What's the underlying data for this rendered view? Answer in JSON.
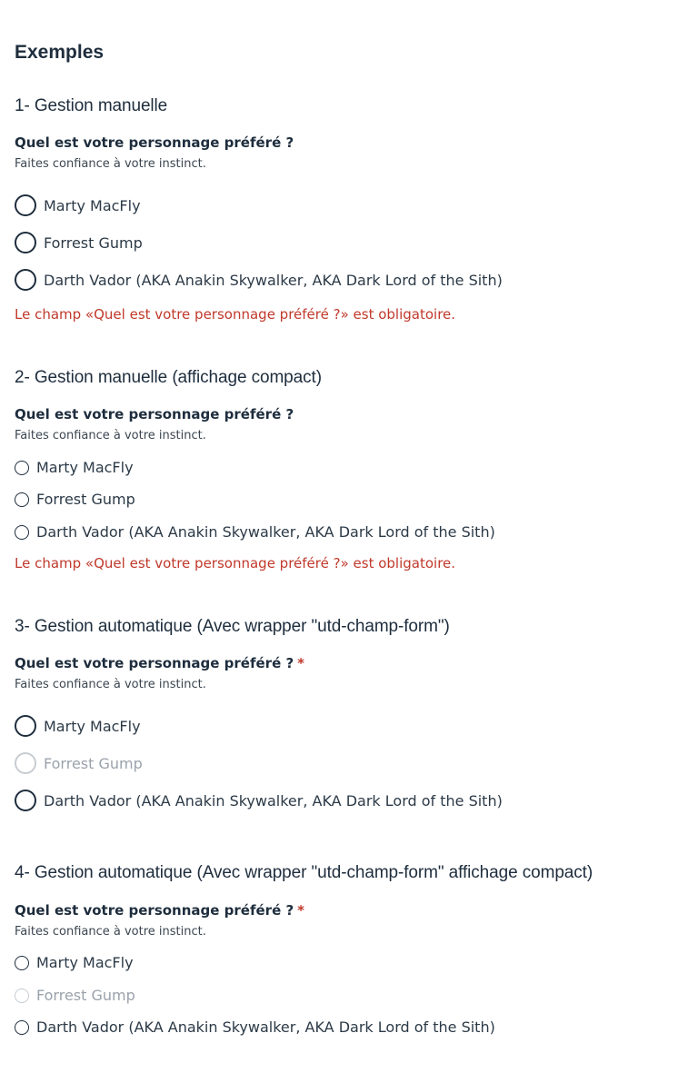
{
  "page": {
    "title": "Exemples"
  },
  "sections": [
    {
      "title": "1- Gestion manuelle",
      "question": "Quel est votre personnage préféré ?",
      "hint": "Faites confiance à votre instinct.",
      "options": [
        "Marty MacFly",
        "Forrest Gump",
        "Darth Vador (AKA Anakin Skywalker, AKA Dark Lord of the Sith)"
      ],
      "error": "Le champ «Quel est votre personnage préféré ?» est obligatoire."
    },
    {
      "title": "2- Gestion manuelle (affichage compact)",
      "question": "Quel est votre personnage préféré ?",
      "hint": "Faites confiance à votre instinct.",
      "options": [
        "Marty MacFly",
        "Forrest Gump",
        "Darth Vador (AKA Anakin Skywalker, AKA Dark Lord of the Sith)"
      ],
      "error": "Le champ «Quel est votre personnage préféré ?» est obligatoire."
    },
    {
      "title": "3- Gestion automatique (Avec wrapper \"utd-champ-form\")",
      "question": "Quel est votre personnage préféré ?",
      "required_marker": "*",
      "hint": "Faites confiance à votre instinct.",
      "options": [
        "Marty MacFly",
        "Forrest Gump",
        "Darth Vador (AKA Anakin Skywalker, AKA Dark Lord of the Sith)"
      ],
      "disabled_option": "Forrest Gump"
    },
    {
      "title": "4- Gestion automatique (Avec wrapper \"utd-champ-form\" affichage compact)",
      "question": "Quel est votre personnage préféré ?",
      "required_marker": "*",
      "hint": "Faites confiance à votre instinct.",
      "options": [
        "Marty MacFly",
        "Forrest Gump",
        "Darth Vador (AKA Anakin Skywalker, AKA Dark Lord of the Sith)"
      ],
      "disabled_option": "Forrest Gump"
    }
  ],
  "colors": {
    "text": "#1e2d3d",
    "error": "#c0392b",
    "disabled": "#c7ccd1"
  }
}
